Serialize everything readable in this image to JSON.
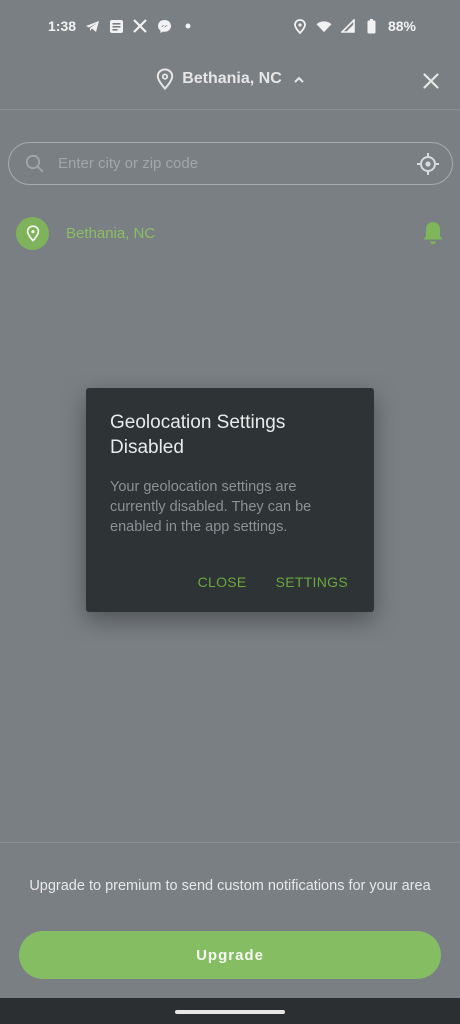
{
  "status_bar": {
    "time": "1:38",
    "battery": "88%",
    "left_icons": [
      "telegram-icon",
      "news-icon",
      "x-icon",
      "messenger-icon",
      "dot-icon"
    ],
    "right_icons": [
      "location-icon",
      "wifi-icon",
      "signal-icon",
      "battery-icon"
    ]
  },
  "header": {
    "location": "Bethania, NC"
  },
  "search": {
    "placeholder": "Enter city or zip code"
  },
  "saved_location": {
    "name": "Bethania, NC"
  },
  "dialog": {
    "title": "Geolocation Settings Disabled",
    "body": "Your geolocation settings are currently disabled. They can be enabled in the app settings.",
    "close_label": "CLOSE",
    "settings_label": "SETTINGS"
  },
  "footer": {
    "text": "Upgrade to premium to send custom notifications for your area",
    "upgrade_label": "Upgrade"
  },
  "colors": {
    "accent_green": "#85bd63",
    "dialog_action": "#6aa83f",
    "dialog_bg": "#2e3336",
    "scrim_bg": "#7a7f83"
  }
}
